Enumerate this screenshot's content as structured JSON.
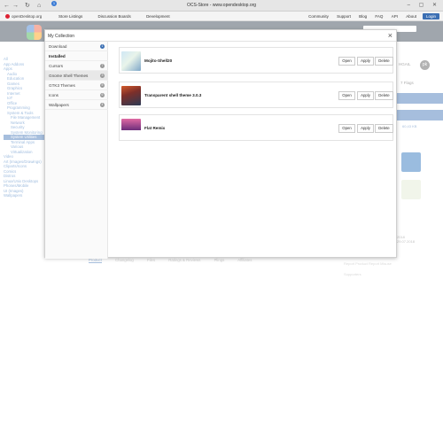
{
  "browser": {
    "title": "OCS-Store - www.opendesktop.org",
    "tab_badge": "1",
    "nav_glyphs": [
      "←",
      "→",
      "↻",
      "⌂"
    ]
  },
  "site_nav": {
    "logo_text": "openDesktop.org",
    "links": [
      "Store Listings",
      "Discussion Boards",
      "Development"
    ],
    "right_links": [
      "Community",
      "Support",
      "Blog",
      "FAQ",
      "API",
      "About"
    ],
    "login_label": "Login"
  },
  "background": {
    "sidebar_items": [
      "All",
      "App Addons",
      "Apps",
      "Audio",
      "Education",
      "Games",
      "Graphics",
      "Internet",
      "IoT",
      "Office",
      "Programming",
      "System & Tools",
      "File Management",
      "Network",
      "Security",
      "System Monitoring",
      "System Utilities",
      "Terminal Apps",
      "Various",
      "Virtualization",
      "Video",
      "Art (Images/Drawings)",
      "Cliparts/Icons",
      "Comics",
      "Distros",
      "Linux/Unix Desktops",
      "Phones/Mobile",
      "UI (Images)",
      "Wallpapers"
    ],
    "selected_sidebar_index": 16,
    "avatar_initials": "pk",
    "user_label": "HGAIL",
    "flags_text": "7 Flags",
    "small_button": "60,43 KB",
    "tabs": [
      "Product",
      "Changelog",
      "Files",
      "Ratings & Reviews",
      "Plings",
      "Affiliates",
      "Reviews"
    ],
    "footer_links": [
      "Report Product",
      "Report Misuse"
    ],
    "footer_note": "Supporters",
    "meta_lines": [
      "2018",
      "29.07.2018"
    ]
  },
  "modal": {
    "title": "My Collection",
    "close_glyph": "×",
    "sidebar": [
      {
        "label": "Download",
        "count": "1",
        "count_color": "#3b6fb3"
      },
      {
        "label": "Installed",
        "count": "",
        "bold": true
      },
      {
        "label": "Cursors",
        "count": "7"
      },
      {
        "label": "Gnome Shell Themes",
        "count": "3",
        "selected": true
      },
      {
        "label": "GTK3 Themes",
        "count": "5"
      },
      {
        "label": "Icons",
        "count": "6"
      },
      {
        "label": "Wallpapers",
        "count": "4"
      }
    ],
    "items": [
      {
        "name": "Mojito-Shell20",
        "open": "Open",
        "apply": "Apply",
        "delete": "Delete"
      },
      {
        "name": "Transparent shell theme 3.0.3",
        "open": "Open",
        "apply": "Apply",
        "delete": "Delete"
      },
      {
        "name": "Flat Remix",
        "open": "Open",
        "apply": "Apply",
        "delete": "Delete"
      }
    ]
  }
}
